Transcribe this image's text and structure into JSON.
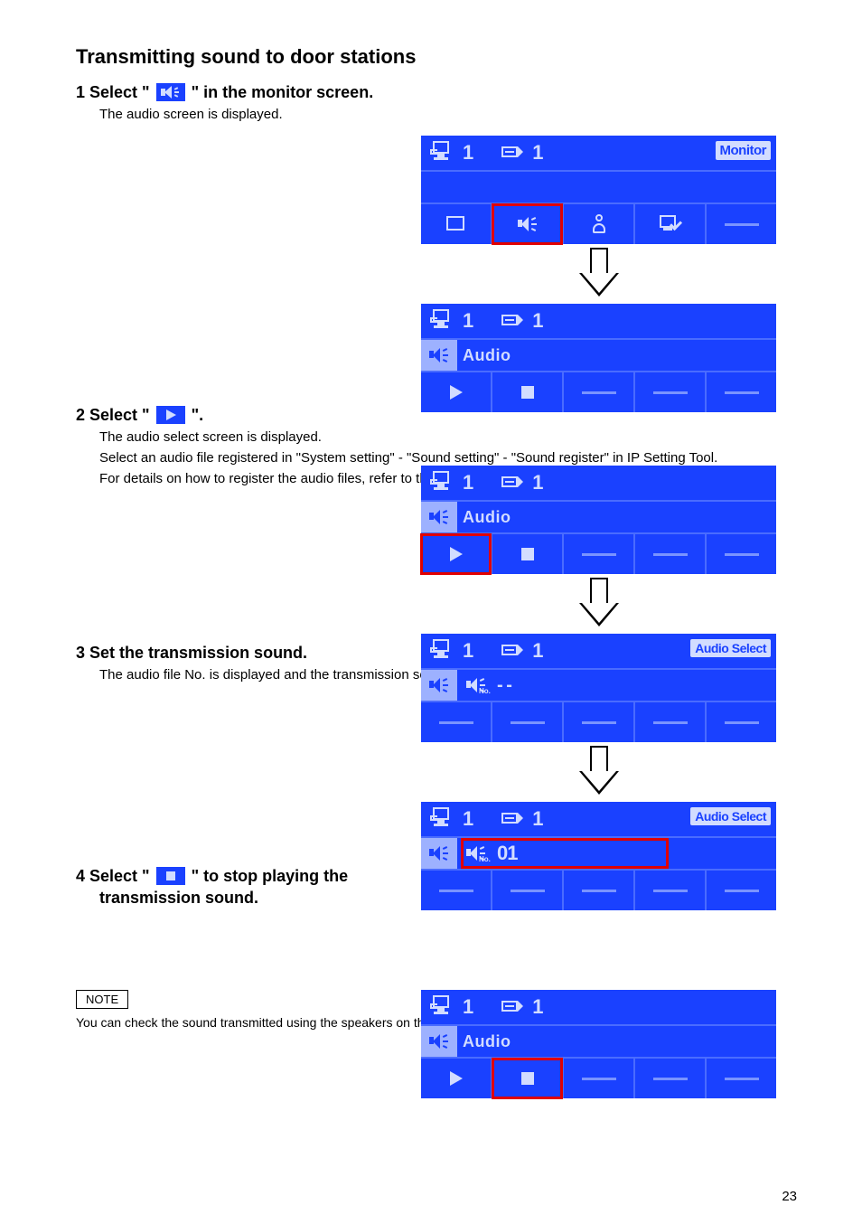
{
  "section_title": "Transmitting sound to door stations",
  "steps": {
    "s1": {
      "head_prefix": "1  Select \"",
      "head_suffix": "\" in the monitor screen.",
      "body": "The audio screen is displayed."
    },
    "s2": {
      "head_prefix": "2  Select \"",
      "head_suffix": "\".",
      "body_l1": "The audio select screen is displayed.",
      "body_l2": "Select an audio file registered in \"System setting\" - \"Sound setting\" - \"Sound register\" in IP Setting Tool.",
      "body_l3": "For details on how to register the audio files, refer to the IP Setting Tool guide."
    },
    "s3": {
      "head": "3  Set the transmission sound.",
      "body": "The audio file No. is displayed and the transmission sound is played."
    },
    "s4": {
      "head_prefix": "4  Select \"",
      "head_suffix": "\" to stop playing the",
      "head_l2": "transmission sound."
    }
  },
  "lcd": {
    "station_no": "1",
    "camera_no": "1",
    "mode_monitor": "Monitor",
    "mode_audioselect": "Audio Select",
    "audio_label": "Audio",
    "audio_no_placeholder": "- -",
    "audio_no_selected": "01",
    "spk_no_label": "No."
  },
  "note": {
    "tag": "NOTE",
    "body": "You can check the sound transmitted using the speakers on the door stations while monitoring the master station."
  },
  "page_number": "23"
}
